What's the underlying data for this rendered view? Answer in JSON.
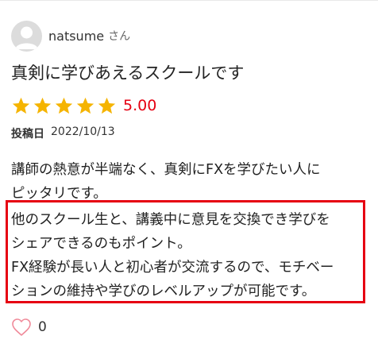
{
  "reviewer": {
    "name": "natsume",
    "suffix": "さん"
  },
  "review": {
    "title": "真剣に学びあえるスクールです",
    "rating": "5.00",
    "stars_filled": 5,
    "stars_total": 5,
    "posted_label": "投稿日",
    "posted_date": "2022/10/13",
    "body_lines": [
      "講師の熱意が半端なく、真剣にFXを学びたい人に",
      "ピッタリです。"
    ],
    "highlight_lines": [
      "他のスクール生と、講義中に意見を交換でき学びを",
      "シェアできるのもポイント。",
      "FX経験が長い人と初心者が交流するので、モチベー",
      "ションの維持や学びのレベルアップが可能です。"
    ]
  },
  "likes": {
    "count": "0"
  },
  "colors": {
    "star": "#f5b400",
    "accent": "#e60012",
    "heart": "#f08a9a",
    "avatar_bg": "#dcdcdc"
  },
  "icons": {
    "avatar": "user-silhouette",
    "star": "star",
    "like": "heart-outline"
  }
}
